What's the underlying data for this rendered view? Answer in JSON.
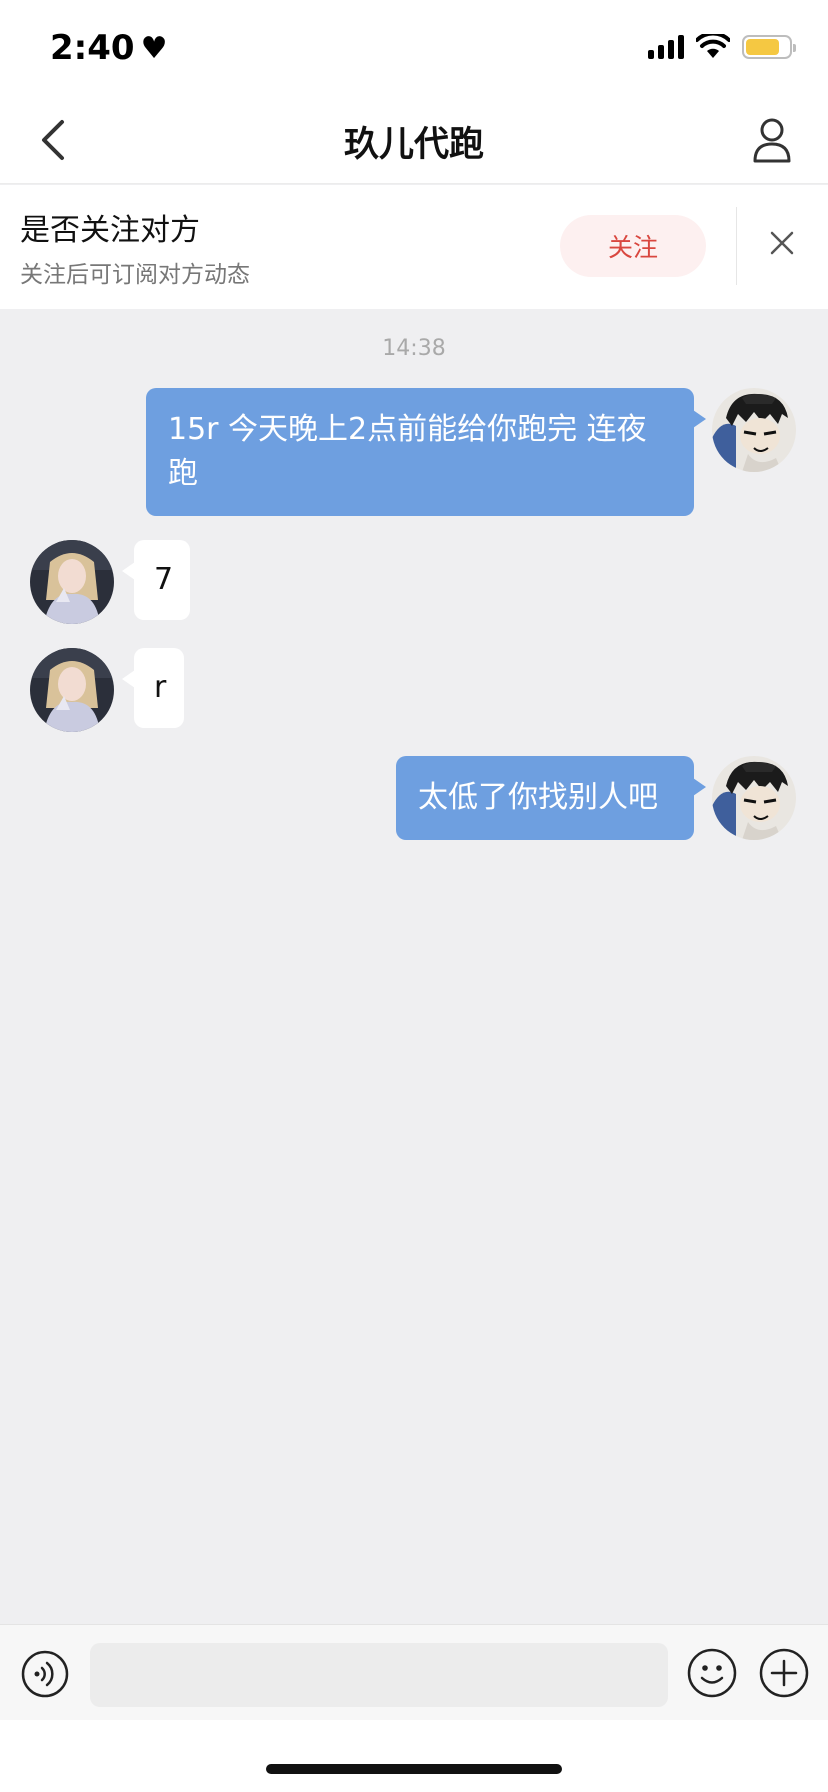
{
  "status_bar": {
    "time": "2:40",
    "heart": "♥"
  },
  "nav": {
    "title": "玖儿代跑"
  },
  "follow_banner": {
    "title": "是否关注对方",
    "subtitle": "关注后可订阅对方动态",
    "button": "关注"
  },
  "chat": {
    "timestamp": "14:38",
    "messages": [
      {
        "direction": "out",
        "text": "15r 今天晚上2点前能给你跑完 连夜跑"
      },
      {
        "direction": "in",
        "text": "7"
      },
      {
        "direction": "in",
        "text": "r"
      },
      {
        "direction": "out",
        "text": "太低了你找别人吧"
      }
    ]
  },
  "input_bar": {
    "placeholder": ""
  },
  "colors": {
    "outgoing_bubble": "#6e9fe0",
    "follow_accent": "#d9473f",
    "follow_button_bg": "#fdf0f0",
    "chat_background": "#efeff1"
  },
  "icons": {
    "back": "chevron-left-icon",
    "profile": "person-icon",
    "close": "close-icon",
    "voice": "voice-icon",
    "emoji": "emoji-icon",
    "plus": "plus-icon"
  }
}
